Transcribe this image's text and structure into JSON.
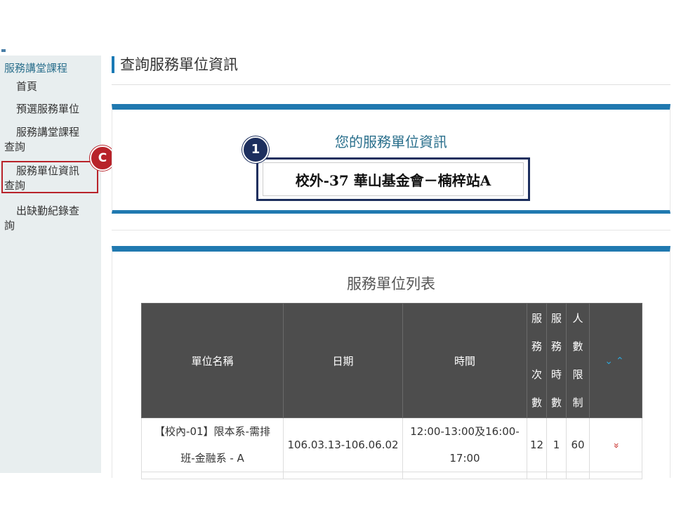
{
  "sidebar": {
    "heading": "服務講堂課程",
    "items": [
      {
        "label": "首頁"
      },
      {
        "label_line1": "預選服務單位"
      },
      {
        "label_line1": "服務講堂課程",
        "label_line2": "查詢"
      },
      {
        "label_line1": "服務單位資訊",
        "label_line2": "查詢"
      },
      {
        "label_line1": "出缺勤紀錄查",
        "label_line2": "詢"
      }
    ],
    "badge": "C"
  },
  "page": {
    "title": "查詢服務單位資訊"
  },
  "info_panel": {
    "title": "您的服務單位資訊",
    "unit_name": "校外-37 華山基金會－楠梓站A",
    "badge": "1"
  },
  "list_panel": {
    "title": "服務單位列表",
    "columns": {
      "unit": "單位名稱",
      "date": "日期",
      "time": "時間",
      "count": [
        "服",
        "務",
        "次",
        "數"
      ],
      "hours": [
        "服",
        "務",
        "時",
        "數"
      ],
      "limit": [
        "人",
        "數",
        "限",
        "制"
      ]
    },
    "sort_icons": "⌄⌃",
    "rows": [
      {
        "unit_line1": "【校內-01】限本系-需排",
        "unit_line2": "班-金融系 - A",
        "date": "106.03.13-106.06.02",
        "time_line1": "12:00-13:00及16:00-",
        "time_line2": "17:00",
        "count": "12",
        "hours": "1",
        "limit": "60",
        "expand_icon": "»"
      }
    ]
  }
}
